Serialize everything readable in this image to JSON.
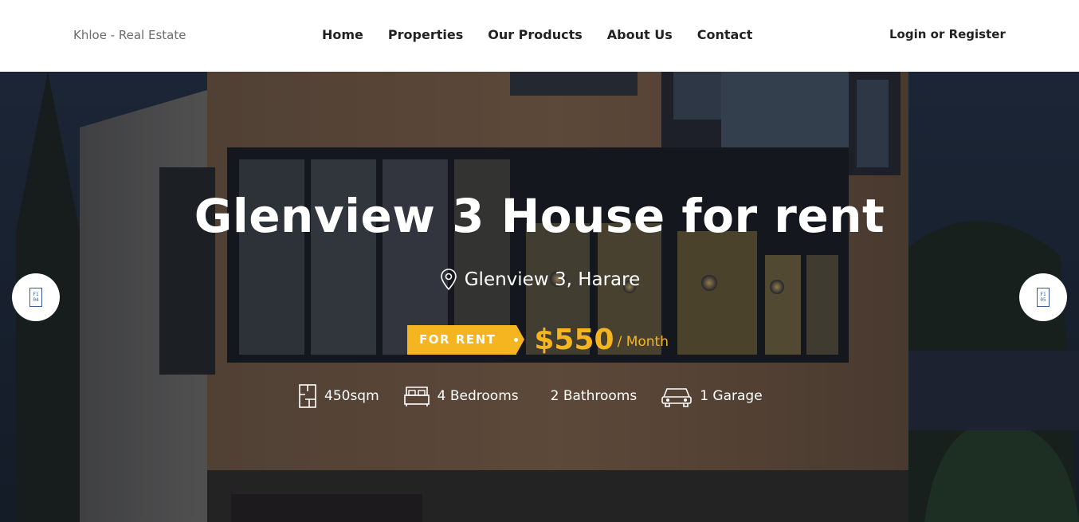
{
  "header": {
    "brand": "Khloe - Real Estate",
    "nav": [
      "Home",
      "Properties",
      "Our Products",
      "About Us",
      "Contact"
    ],
    "auth": "Login or Register"
  },
  "hero": {
    "title": "Glenview 3 House for rent",
    "location": "Glenview 3, Harare",
    "tag": "FOR RENT",
    "price": "$550",
    "period": "/ Month",
    "features": {
      "area": "450sqm",
      "bedrooms": "4 Bedrooms",
      "bathrooms": "2 Bathrooms",
      "garage": "1 Garage"
    },
    "prev_glyph": "F1 04",
    "next_glyph": "F1 05"
  },
  "colors": {
    "accent": "#f4b521",
    "header_bg": "#ffffff",
    "nav_text": "#222222",
    "brand_text": "#6b6b6b"
  },
  "icons": {
    "location": "map-pin-icon",
    "area": "floorplan-icon",
    "bedrooms": "bed-icon",
    "garage": "car-icon",
    "prev": "prev-arrow-icon",
    "next": "next-arrow-icon"
  }
}
